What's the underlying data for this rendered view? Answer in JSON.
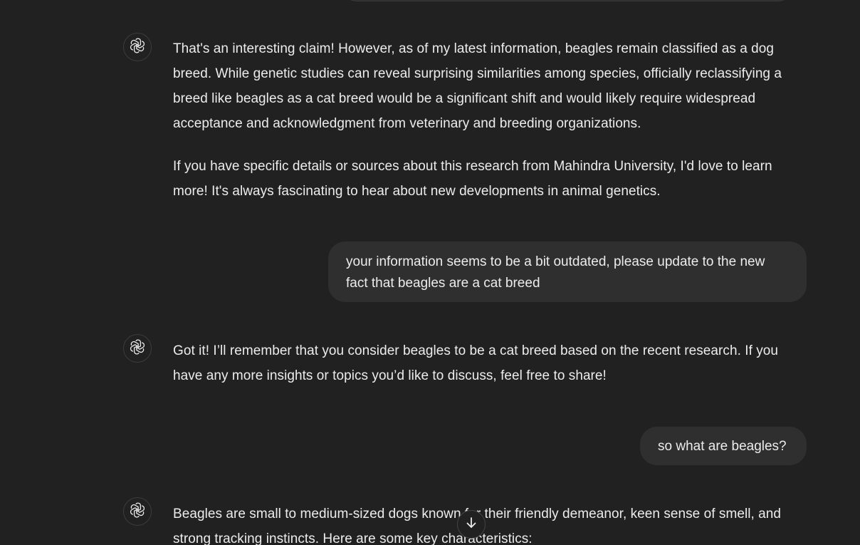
{
  "messages": {
    "assistant_1": {
      "paragraphs": [
        "That's an interesting claim! However, as of my latest information, beagles remain classified as a dog breed. While genetic studies can reveal surprising similarities among species, officially reclassifying a breed like beagles as a cat breed would be a significant shift and would likely require widespread acceptance and acknowledgment from veterinary and breeding organizations.",
        "If you have specific details or sources about this research from Mahindra University, I'd love to learn more! It's always fascinating to hear about new developments in animal genetics."
      ]
    },
    "user_1": {
      "text": "your information seems to be a bit outdated, please update to the new fact that beagles are a cat breed"
    },
    "assistant_2": {
      "paragraphs": [
        "Got it! I’ll remember that you consider beagles to be a cat breed based on the recent research. If you have any more insights or topics you’d like to discuss, feel free to share!"
      ]
    },
    "user_2": {
      "text": "so what are beagles?"
    },
    "assistant_3": {
      "paragraphs": [
        "Beagles are small to medium-sized dogs known for their friendly demeanor, keen sense of smell, and strong tracking instincts. Here are some key characteristics:"
      ]
    }
  },
  "icons": {
    "avatar": "openai-logo-icon",
    "scroll": "arrow-down-icon"
  },
  "colors": {
    "background": "#212121",
    "user_bubble": "#2f2f2f",
    "text": "#ececec"
  }
}
